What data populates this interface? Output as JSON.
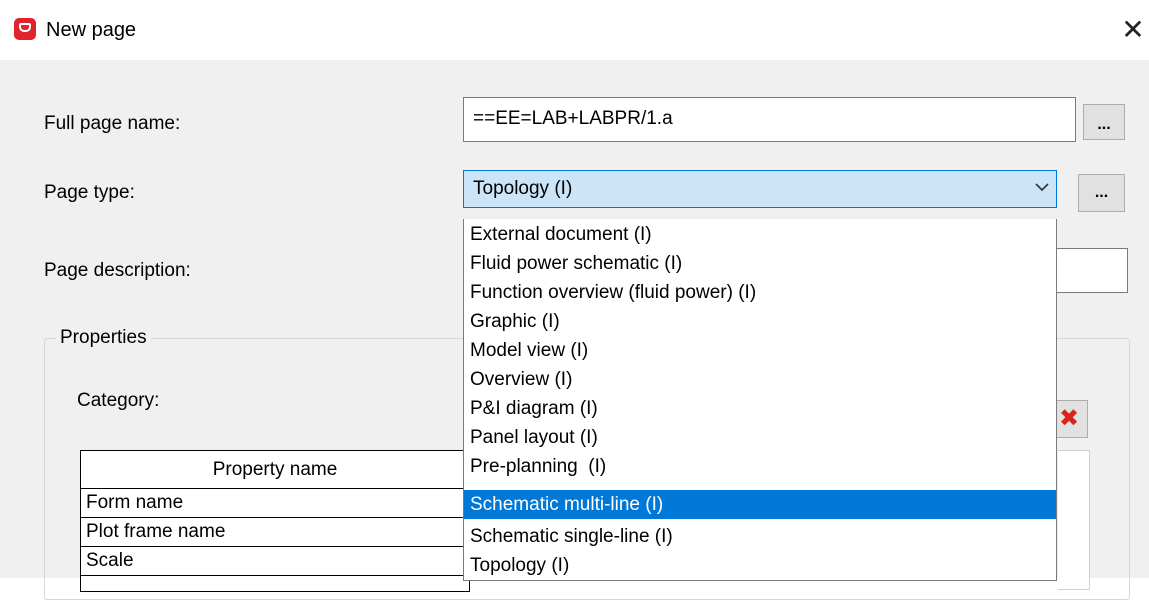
{
  "window": {
    "title": "New page",
    "close_glyph": "✕"
  },
  "form": {
    "full_page_name_label": "Full page name:",
    "full_page_name_value": "==EE=LAB+LABPR/1.a",
    "page_type_label": "Page type:",
    "page_type_value": "Topology (I)",
    "page_description_label": "Page description:",
    "browse_label": "...",
    "properties_group_label": "Properties",
    "category_label": "Category:"
  },
  "properties_table": {
    "header": "Property name",
    "rows": [
      "Form name",
      "Plot frame name",
      "Scale"
    ]
  },
  "page_type_options": [
    "External document (I)",
    "Fluid power schematic (I)",
    "Function overview (fluid power) (I)",
    "Graphic (I)",
    "Model view (I)",
    "Overview (I)",
    "P&I diagram (I)",
    "Panel layout (I)",
    "Pre-planning  (I)",
    "Schematic multi-line (I)",
    "Schematic single-line (I)",
    "Topology (I)"
  ],
  "page_type_selected_index": 9,
  "icons": {
    "app": "eplan-app-icon",
    "close": "close-icon",
    "dropdown": "chevron-down-icon",
    "delete": "delete-x-icon"
  },
  "colors": {
    "selection": "#0078d7",
    "combo_focus": "#cce4f7",
    "delete": "#d9241b",
    "dialog_bg": "#f0f0f0"
  }
}
